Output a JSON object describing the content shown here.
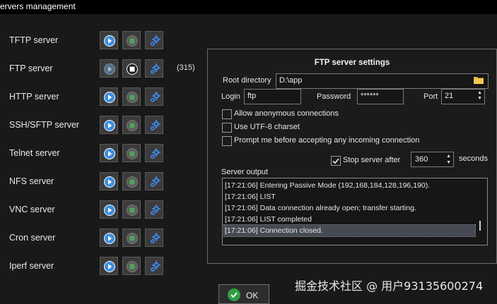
{
  "window": {
    "title": "ervers management"
  },
  "servers": [
    {
      "name": "TFTP server",
      "running": false,
      "connections": ""
    },
    {
      "name": "FTP server",
      "running": true,
      "connections": "(315)"
    },
    {
      "name": "HTTP server",
      "running": false,
      "connections": ""
    },
    {
      "name": "SSH/SFTP server",
      "running": false,
      "connections": ""
    },
    {
      "name": "Telnet server",
      "running": false,
      "connections": ""
    },
    {
      "name": "NFS server",
      "running": false,
      "connections": ""
    },
    {
      "name": "VNC server",
      "running": false,
      "connections": ""
    },
    {
      "name": "Cron server",
      "running": false,
      "connections": ""
    },
    {
      "name": "Iperf server",
      "running": false,
      "connections": ""
    }
  ],
  "ftp_settings": {
    "title": "FTP server settings",
    "root_label": "Root directory",
    "root_value": "D:\\app",
    "login_label": "Login",
    "login_value": "ftp",
    "password_label": "Password",
    "password_value": "******",
    "port_label": "Port",
    "port_value": "21",
    "anonymous_label": "Allow anonymous connections",
    "anonymous_checked": false,
    "utf8_label": "Use UTF-8 charset",
    "utf8_checked": false,
    "prompt_label": "Prompt me before accepting any incoming connection",
    "prompt_checked": false,
    "stop_label": "Stop server after",
    "stop_checked": true,
    "stop_value": "360",
    "stop_unit": "seconds",
    "output_label": "Server output",
    "output_lines": [
      "[17:21:06] Entering Passive Mode (192,168,184,128,196,190).",
      "[17:21:06] LIST",
      "[17:21:06] Data connection already open; transfer starting.",
      "[17:21:06] LIST completed",
      "[17:21:06] Connection closed."
    ],
    "selected_line": 4
  },
  "ok_button": {
    "label": "OK"
  },
  "watermark": "掘金技术社区 @ 用户93135600274",
  "colors": {
    "play": "#3d8ee0",
    "stop_active": "#ffffff",
    "stop_idle": "#4fa45a",
    "gear": "#3f7fd9",
    "ok_check": "#2f9e44",
    "folder": "#e8b53a"
  }
}
